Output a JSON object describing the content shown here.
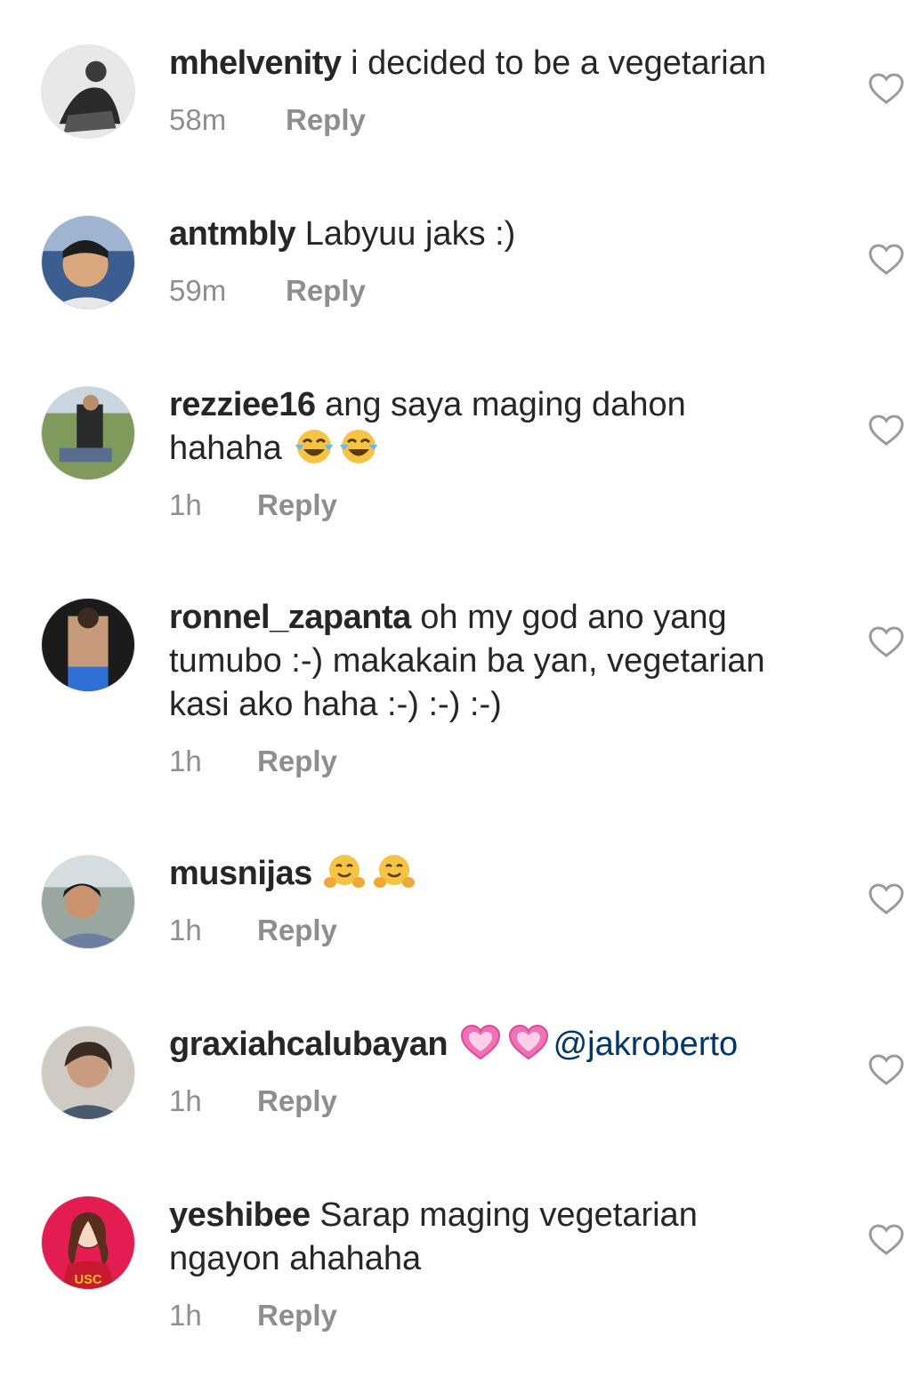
{
  "comments": [
    {
      "username": "mhelvenity",
      "text": "i decided to be a vegetarian",
      "time": "58m",
      "reply": "Reply"
    },
    {
      "username": "antmbly",
      "text": "Labyuu jaks :)",
      "time": "59m",
      "reply": "Reply"
    },
    {
      "username": "rezziee16",
      "text": "ang saya maging dahon",
      "text2": "hahaha",
      "emoji": "face-with-tears-of-joy x2",
      "time": "1h",
      "reply": "Reply"
    },
    {
      "username": "ronnel_zapanta",
      "text": "oh my god ano yang",
      "text2": "tumubo :-) makakain ba yan, vegetarian",
      "text3": "kasi ako haha :-) :-) :-)",
      "time": "1h",
      "reply": "Reply"
    },
    {
      "username": "musnijas",
      "emoji": "hugging-face x2",
      "time": "1h",
      "reply": "Reply"
    },
    {
      "username": "graxiahcalubayan",
      "emoji": "growing-heart x2",
      "mention": "@jakroberto",
      "time": "1h",
      "reply": "Reply"
    },
    {
      "username": "yeshibee",
      "text": "Sarap maging vegetarian",
      "text2": "ngayon ahahaha",
      "time": "1h",
      "reply": "Reply",
      "avatar_text": "USC"
    }
  ],
  "icons": {
    "like": "heart-outline-icon"
  },
  "colors": {
    "username": "#262626",
    "meta": "#8e8e8e",
    "mention": "#003569",
    "heart": "#9a9a9a"
  }
}
